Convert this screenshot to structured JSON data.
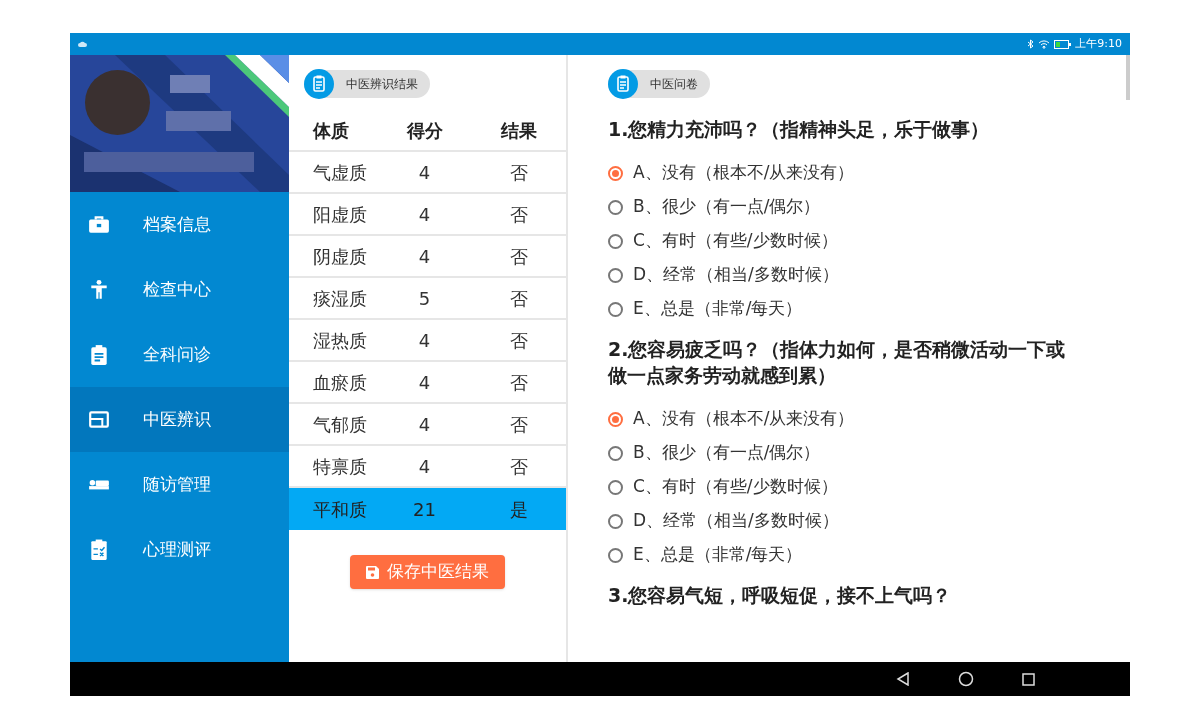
{
  "status_bar": {
    "time": "上午9:10"
  },
  "sidebar": {
    "items": [
      {
        "label": "档案信息",
        "selected": false
      },
      {
        "label": "检查中心",
        "selected": false
      },
      {
        "label": "全科问诊",
        "selected": false
      },
      {
        "label": "中医辨识",
        "selected": true
      },
      {
        "label": "随访管理",
        "selected": false
      },
      {
        "label": "心理测评",
        "selected": false
      }
    ]
  },
  "result_panel": {
    "title": "中医辨识结果",
    "columns": [
      "体质",
      "得分",
      "结果"
    ],
    "rows": [
      {
        "cells": [
          "气虚质",
          "4",
          "否"
        ],
        "selected": false
      },
      {
        "cells": [
          "阳虚质",
          "4",
          "否"
        ],
        "selected": false
      },
      {
        "cells": [
          "阴虚质",
          "4",
          "否"
        ],
        "selected": false
      },
      {
        "cells": [
          "痰湿质",
          "5",
          "否"
        ],
        "selected": false
      },
      {
        "cells": [
          "湿热质",
          "4",
          "否"
        ],
        "selected": false
      },
      {
        "cells": [
          "血瘀质",
          "4",
          "否"
        ],
        "selected": false
      },
      {
        "cells": [
          "气郁质",
          "4",
          "否"
        ],
        "selected": false
      },
      {
        "cells": [
          "特禀质",
          "4",
          "否"
        ],
        "selected": false
      },
      {
        "cells": [
          "平和质",
          "21",
          "是"
        ],
        "selected": true
      }
    ],
    "save_button": "保存中医结果"
  },
  "questionnaire": {
    "title": "中医问卷",
    "questions": [
      {
        "text": "1.您精力充沛吗？（指精神头足，乐于做事）",
        "options": [
          {
            "label": "A、没有（根本不/从来没有）",
            "selected": true
          },
          {
            "label": "B、很少（有一点/偶尔）",
            "selected": false
          },
          {
            "label": "C、有时（有些/少数时候）",
            "selected": false
          },
          {
            "label": "D、经常（相当/多数时候）",
            "selected": false
          },
          {
            "label": "E、总是（非常/每天）",
            "selected": false
          }
        ]
      },
      {
        "text": "2.您容易疲乏吗？（指体力如何，是否稍微活动一下或做一点家务劳动就感到累）",
        "options": [
          {
            "label": "A、没有（根本不/从来没有）",
            "selected": true
          },
          {
            "label": "B、很少（有一点/偶尔）",
            "selected": false
          },
          {
            "label": "C、有时（有些/少数时候）",
            "selected": false
          },
          {
            "label": "D、经常（相当/多数时候）",
            "selected": false
          },
          {
            "label": "E、总是（非常/每天）",
            "selected": false
          }
        ]
      },
      {
        "text": "3.您容易气短，呼吸短促，接不上气吗？"
      }
    ]
  }
}
